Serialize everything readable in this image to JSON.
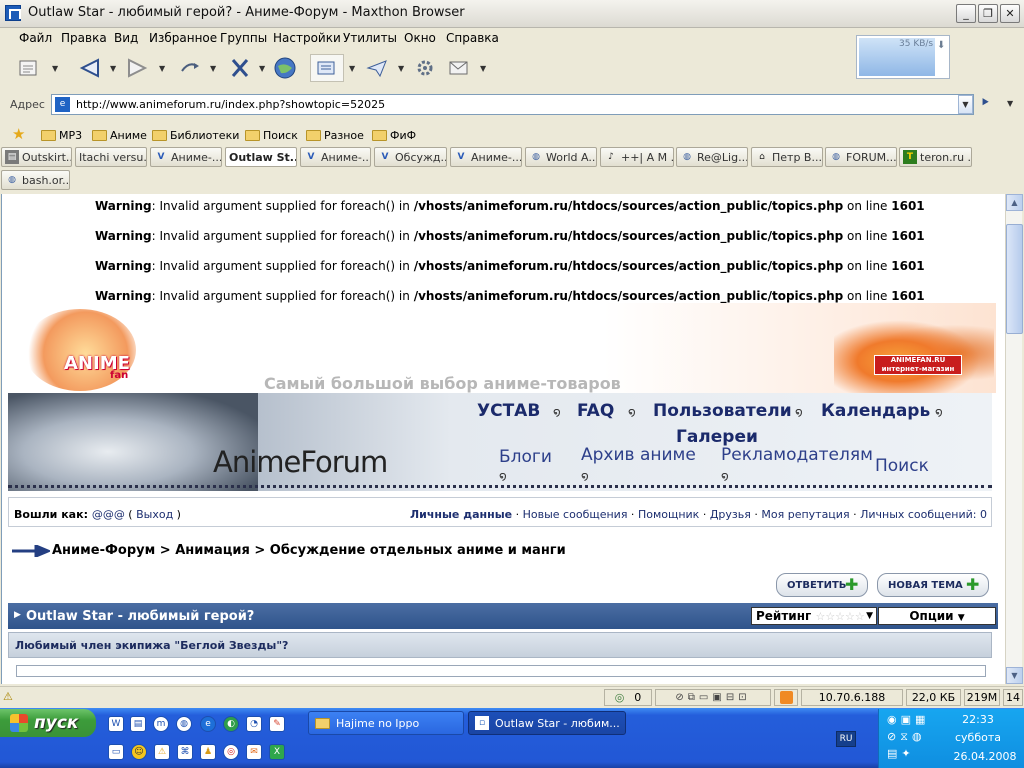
{
  "window": {
    "title": "Outlaw Star - любимый герой? - Аниме-Форум - Maxthon Browser",
    "controls": [
      "_",
      "❐",
      "✕"
    ]
  },
  "menu": [
    "Файл",
    "Правка",
    "Вид",
    "Избранное",
    "Группы",
    "Настройки",
    "Утилиты",
    "Окно",
    "Справка"
  ],
  "toolbar": {
    "buttons": [
      "new-page-icon",
      "back-icon",
      "forward-icon",
      "refresh-icon",
      "stop-icon",
      "home-icon",
      "favorites-icon",
      "send-icon",
      "tools-icon",
      "mail-icon"
    ],
    "net_speed": "35 KB/s"
  },
  "address": {
    "label": "Адрес",
    "url": "http://www.animeforum.ru/index.php?showtopic=52025"
  },
  "favorites": [
    "MP3",
    "Аниме",
    "Библиотеки",
    "Поиск",
    "Разное",
    "ФиФ"
  ],
  "tabs": [
    {
      "label": "Outskirt...",
      "active": false
    },
    {
      "label": "Itachi versu...",
      "active": false
    },
    {
      "label": "Аниме-...",
      "active": false
    },
    {
      "label": "Outlaw St...",
      "active": true
    },
    {
      "label": "Аниме-...",
      "active": false
    },
    {
      "label": "Обсужд...",
      "active": false
    },
    {
      "label": "Аниме-...",
      "active": false
    },
    {
      "label": "World A...",
      "active": false
    },
    {
      "label": "++| A M ...",
      "active": false
    },
    {
      "label": "Re@Lig...",
      "active": false
    },
    {
      "label": "Петр В...",
      "active": false
    },
    {
      "label": "FORUM...",
      "active": false
    },
    {
      "label": "teron.ru ...",
      "active": false
    },
    {
      "label": "bash.or...",
      "active": false
    }
  ],
  "page": {
    "warnings": [
      {
        "label": "Warning",
        "text": ": Invalid argument supplied for foreach() in ",
        "path": "/vhosts/animeforum.ru/htdocs/sources/action_public/topics.php",
        "on": " on line ",
        "line": "1601"
      },
      {
        "label": "Warning",
        "text": ": Invalid argument supplied for foreach() in ",
        "path": "/vhosts/animeforum.ru/htdocs/sources/action_public/topics.php",
        "on": " on line ",
        "line": "1601"
      },
      {
        "label": "Warning",
        "text": ": Invalid argument supplied for foreach() in ",
        "path": "/vhosts/animeforum.ru/htdocs/sources/action_public/topics.php",
        "on": " on line ",
        "line": "1601"
      },
      {
        "label": "Warning",
        "text": ": Invalid argument supplied for foreach() in ",
        "path": "/vhosts/animeforum.ru/htdocs/sources/action_public/topics.php",
        "on": " on line ",
        "line": "1601"
      }
    ],
    "banner": {
      "tagline": "Самый большой выбор аниме-товаров",
      "logo_main": "ANIME",
      "logo_sub": "fan",
      "shop_name": "ANIMEFAN.RU",
      "shop_sub": "интернет-магазин"
    },
    "forum_title": "AnimeForum",
    "nav": {
      "rules": "УСТАВ",
      "faq": "FAQ",
      "users": "Пользователи",
      "calendar": "Календарь",
      "galleries": "Галереи",
      "blogs": "Блоги",
      "archive": "Архив аниме",
      "advertisers": "Рекламодателям",
      "search": "Поиск"
    },
    "login": {
      "prefix": "Вошли как: ",
      "user": "@@@",
      "logout": "Выход",
      "links": [
        "Личные данные",
        "Новые сообщения",
        "Помощник",
        "Друзья",
        "Моя репутация",
        "Личных сообщений: 0"
      ]
    },
    "breadcrumb": [
      "Аниме-Форум",
      "Анимация",
      "Обсуждение отдельных аниме и манги"
    ],
    "buttons": {
      "reply": "ОТВЕТИТЬ",
      "new_topic": "НОВАЯ ТЕМА"
    },
    "topic": {
      "title": "Outlaw Star - любимый герой?",
      "rating_label": "Рейтинг",
      "rating_stars": 0,
      "options_label": "Опции"
    },
    "poll_question": "Любимый член экипижа \"Беглой Звезды\"?"
  },
  "status": {
    "count": "0",
    "ip": "10.70.6.188",
    "size": "22,0 КБ",
    "memory": "219M",
    "extra": "14"
  },
  "taskbar": {
    "start": "пуск",
    "windows": [
      {
        "label": "Hajime no Ippo",
        "active": false
      },
      {
        "label": "Outlaw Star - любим...",
        "active": true
      }
    ],
    "lang": "RU",
    "time": "22:33",
    "day": "суббота",
    "date": "26.04.2008"
  },
  "colors": {
    "topic_bar": "#2f548b",
    "nav_text": "#1b2a6b",
    "taskbar": "#245edb",
    "start_green": "#3c9c3b"
  }
}
